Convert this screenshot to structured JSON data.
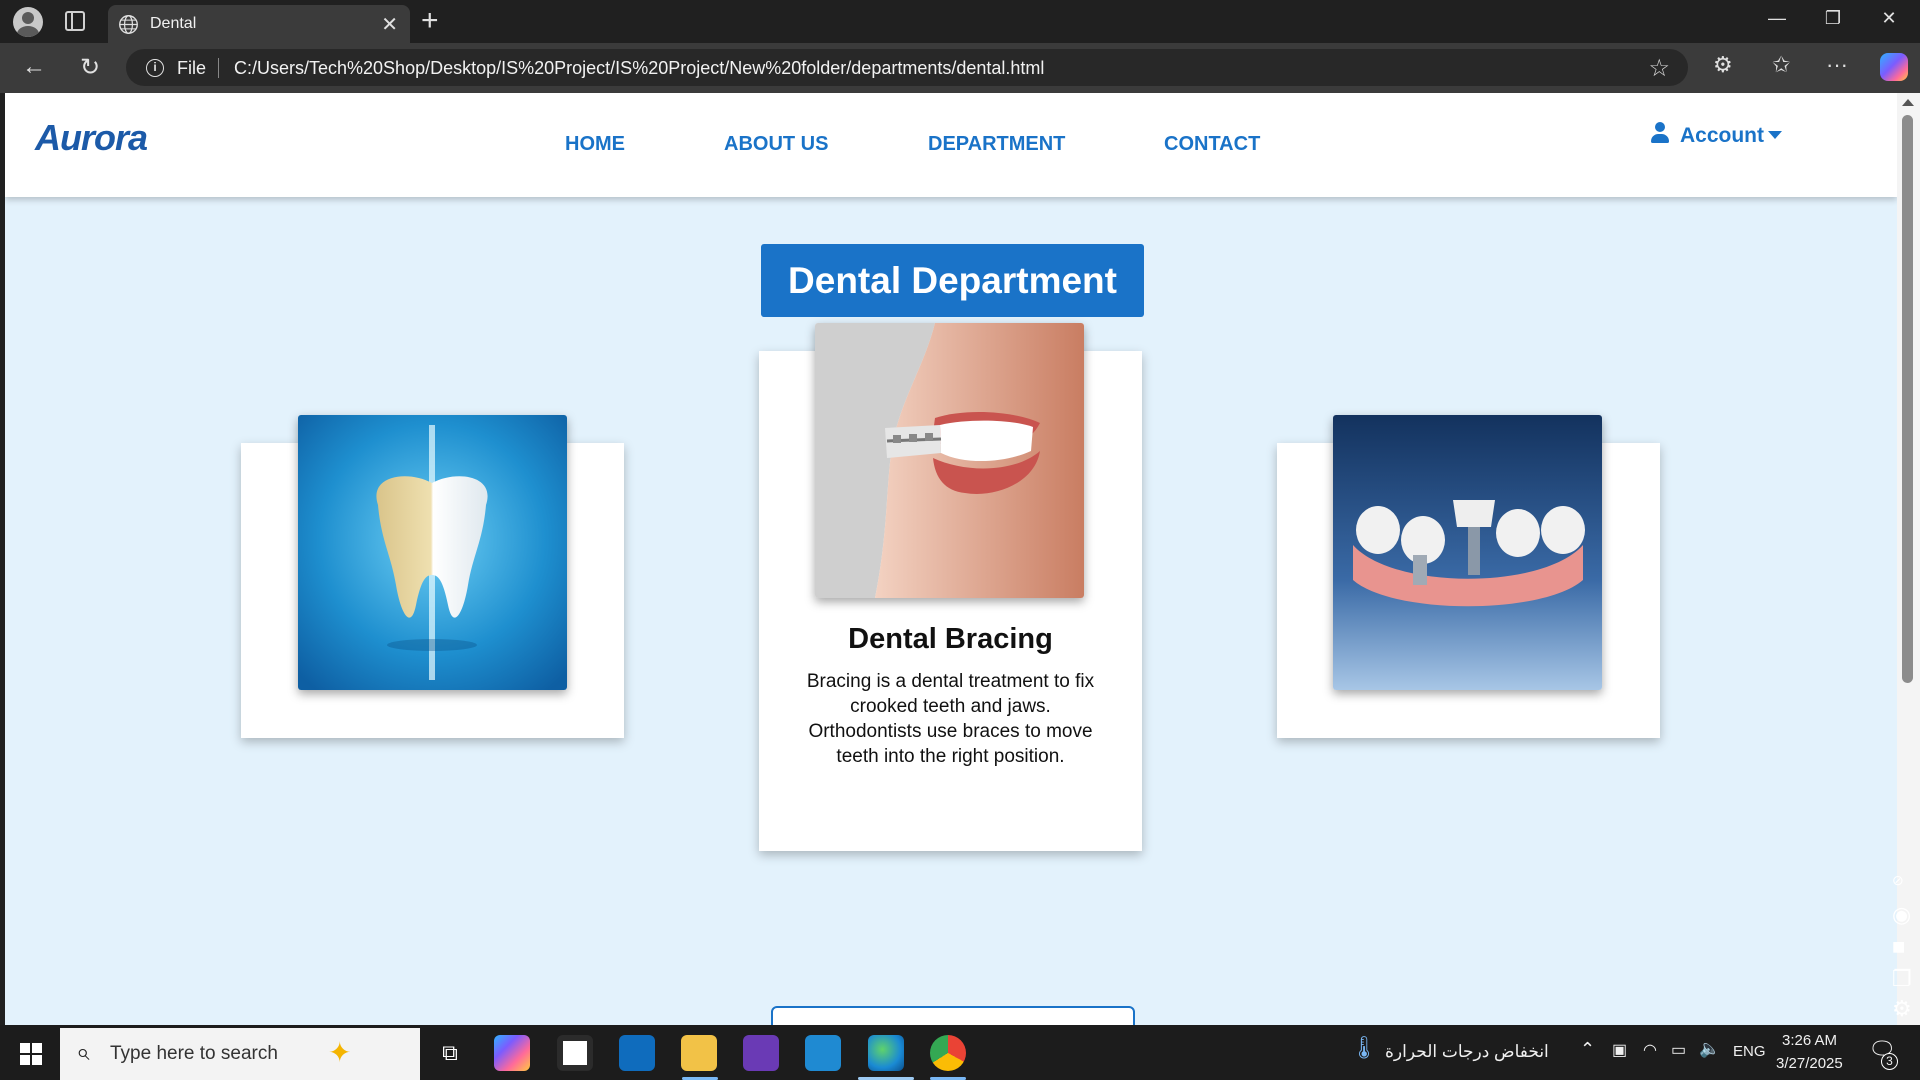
{
  "browser": {
    "tab_title": "Dental",
    "file_label": "File",
    "url": "C:/Users/Tech%20Shop/Desktop/IS%20Project/IS%20Project/New%20folder/departments/dental.html"
  },
  "site": {
    "logo": "Aurora",
    "nav": [
      "HOME",
      "ABOUT US",
      "DEPARTMENT",
      "CONTACT"
    ],
    "account_label": "Account",
    "page_title": "Dental Department",
    "cards": [
      {
        "image": "whitening-tooth",
        "title": "",
        "text": ""
      },
      {
        "image": "smile-with-braces",
        "title": "Dental Bracing",
        "text": "Bracing is a dental treatment to fix crooked teeth and jaws. Orthodontists use braces to move teeth into the right position."
      },
      {
        "image": "dental-implant",
        "title": "",
        "text": ""
      }
    ],
    "accent_color": "#1a73c8",
    "background_color": "#e3f2fc"
  },
  "taskbar": {
    "search_placeholder": "Type here to search",
    "weather_text": "انخفاض درجات الحرارة",
    "language": "ENG",
    "time": "3:26 AM",
    "date": "3/27/2025",
    "notification_count": "3"
  }
}
